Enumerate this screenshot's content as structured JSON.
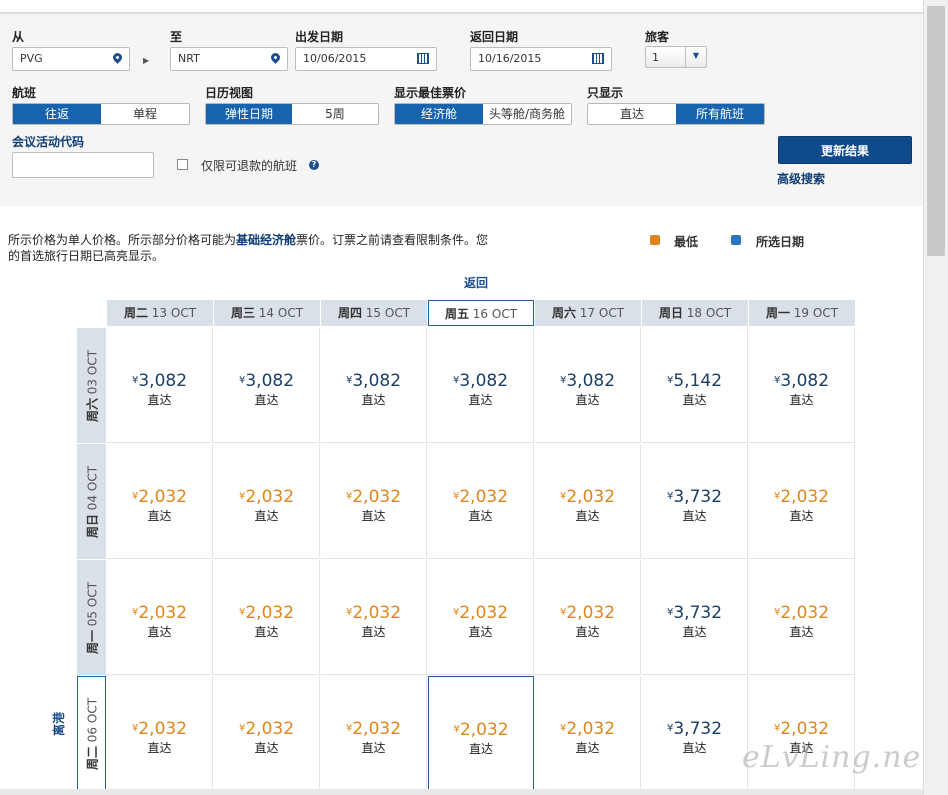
{
  "form": {
    "from_label": "从",
    "from_value": "PVG",
    "to_label": "至",
    "to_value": "NRT",
    "depart_label": "出发日期",
    "depart_value": "10/06/2015",
    "return_label": "返回日期",
    "return_value": "10/16/2015",
    "passengers_label": "旅客",
    "passengers_value": "1",
    "trip_label": "航班",
    "trip_options": [
      "往返",
      "单程"
    ],
    "trip_selected": "往返",
    "calendar_label": "日历视图",
    "calendar_options": [
      "弹性日期",
      "5周"
    ],
    "calendar_selected": "弹性日期",
    "fare_label": "显示最佳票价",
    "fare_options": [
      "经济舱",
      "头等舱/商务舱"
    ],
    "fare_selected": "经济舱",
    "show_label": "只显示",
    "show_options": [
      "直达",
      "所有航班"
    ],
    "show_selected": "所有航班",
    "promo_label": "会议活动代码",
    "promo_value": "",
    "refundable_label": "仅限可退款的航班",
    "refundable_checked": false,
    "help_glyph": "?",
    "update_button": "更新结果",
    "advanced_link": "高级搜索"
  },
  "disclaimer": {
    "part1": "所示价格为单人价格。所示部分价格可能为",
    "highlight": "基础经济舱",
    "part2": "票价。订票之前请查看限制条件。您的首选旅行日期已高亮显示。"
  },
  "legend": {
    "lowest_label": "最低",
    "lowest_color": "#e0851a",
    "selected_label": "所选日期",
    "selected_color": "#2f74c0"
  },
  "grid": {
    "return_axis_label": "返回",
    "depart_axis_label": "离港",
    "currency": "¥",
    "columns": [
      {
        "weekday": "周二",
        "date": "13 OCT"
      },
      {
        "weekday": "周三",
        "date": "14 OCT"
      },
      {
        "weekday": "周四",
        "date": "15 OCT"
      },
      {
        "weekday": "周五",
        "date": "16 OCT"
      },
      {
        "weekday": "周六",
        "date": "17 OCT"
      },
      {
        "weekday": "周日",
        "date": "18 OCT"
      },
      {
        "weekday": "周一",
        "date": "19 OCT"
      }
    ],
    "selected_column": 3,
    "rows": [
      {
        "weekday": "周六",
        "date": "03 OCT",
        "cells": [
          {
            "price": "3,082",
            "stop": "直达",
            "lowest": false
          },
          {
            "price": "3,082",
            "stop": "直达",
            "lowest": false
          },
          {
            "price": "3,082",
            "stop": "直达",
            "lowest": false
          },
          {
            "price": "3,082",
            "stop": "直达",
            "lowest": false
          },
          {
            "price": "3,082",
            "stop": "直达",
            "lowest": false
          },
          {
            "price": "5,142",
            "stop": "直达",
            "lowest": false
          },
          {
            "price": "3,082",
            "stop": "直达",
            "lowest": false
          }
        ]
      },
      {
        "weekday": "周日",
        "date": "04 OCT",
        "cells": [
          {
            "price": "2,032",
            "stop": "直达",
            "lowest": true
          },
          {
            "price": "2,032",
            "stop": "直达",
            "lowest": true
          },
          {
            "price": "2,032",
            "stop": "直达",
            "lowest": true
          },
          {
            "price": "2,032",
            "stop": "直达",
            "lowest": true
          },
          {
            "price": "2,032",
            "stop": "直达",
            "lowest": true
          },
          {
            "price": "3,732",
            "stop": "直达",
            "lowest": false
          },
          {
            "price": "2,032",
            "stop": "直达",
            "lowest": true
          }
        ]
      },
      {
        "weekday": "周一",
        "date": "05 OCT",
        "cells": [
          {
            "price": "2,032",
            "stop": "直达",
            "lowest": true
          },
          {
            "price": "2,032",
            "stop": "直达",
            "lowest": true
          },
          {
            "price": "2,032",
            "stop": "直达",
            "lowest": true
          },
          {
            "price": "2,032",
            "stop": "直达",
            "lowest": true
          },
          {
            "price": "2,032",
            "stop": "直达",
            "lowest": true
          },
          {
            "price": "3,732",
            "stop": "直达",
            "lowest": false
          },
          {
            "price": "2,032",
            "stop": "直达",
            "lowest": true
          }
        ]
      },
      {
        "weekday": "周二",
        "date": "06 OCT",
        "cells": [
          {
            "price": "2,032",
            "stop": "直达",
            "lowest": true
          },
          {
            "price": "2,032",
            "stop": "直达",
            "lowest": true
          },
          {
            "price": "2,032",
            "stop": "直达",
            "lowest": true
          },
          {
            "price": "2,032",
            "stop": "直达",
            "lowest": true
          },
          {
            "price": "2,032",
            "stop": "直达",
            "lowest": true
          },
          {
            "price": "3,732",
            "stop": "直达",
            "lowest": false
          },
          {
            "price": "2,032",
            "stop": "直达",
            "lowest": true
          }
        ]
      }
    ],
    "selected_row": 3
  },
  "watermark": "eLvLing.net"
}
